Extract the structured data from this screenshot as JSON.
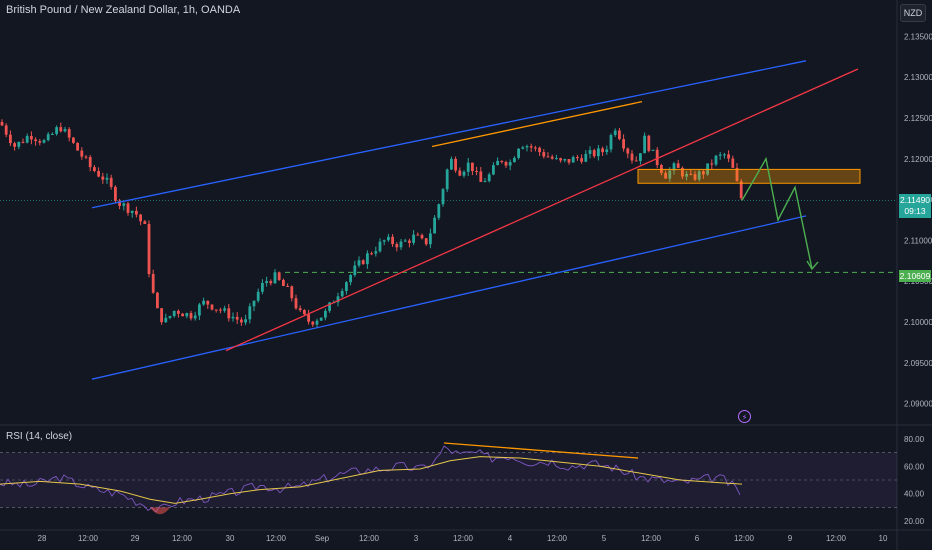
{
  "header": {
    "title": "British Pound / New Zealand Dollar, 1h, OANDA",
    "currency": "NZD"
  },
  "rsi": {
    "title": "RSI (14, close)"
  },
  "badges": {
    "price": "2.11490",
    "countdown": "09:13",
    "level": "2.10609"
  },
  "colors": {
    "background": "#131722",
    "bull": "#26a69a",
    "bear": "#ef5350",
    "channel": "#2962ff",
    "trend": "#f23645",
    "divergence": "#ff9800",
    "projection": "#4caf50",
    "rsi_line": "#7e57c2",
    "rsi_ma": "#e6c84a"
  },
  "chart_data": [
    {
      "type": "candlestick",
      "title": "British Pound / New Zealand Dollar, 1h, OANDA",
      "x_ticks": [
        "28",
        "12:00",
        "29",
        "12:00",
        "30",
        "12:00",
        "Sep",
        "12:00",
        "3",
        "12:00",
        "4",
        "12:00",
        "5",
        "12:00",
        "6",
        "12:00",
        "9",
        "12:00",
        "10"
      ],
      "y_ticks": [
        "2.13500",
        "2.13000",
        "2.12500",
        "2.12000",
        "2.11500",
        "2.11000",
        "2.10500",
        "2.10000",
        "2.09500",
        "2.09000"
      ],
      "ylim": [
        2.088,
        2.137
      ],
      "current_price": 2.1149,
      "key_level": 2.10609,
      "path": [
        [
          0,
          2.1245
        ],
        [
          15,
          2.1215
        ],
        [
          30,
          2.123
        ],
        [
          45,
          2.122
        ],
        [
          60,
          2.124
        ],
        [
          75,
          2.1215
        ],
        [
          90,
          2.119
        ],
        [
          105,
          2.1175
        ],
        [
          120,
          2.1145
        ],
        [
          135,
          2.1135
        ],
        [
          145,
          2.1115
        ],
        [
          150,
          2.105
        ],
        [
          158,
          2.101
        ],
        [
          165,
          2.1
        ],
        [
          175,
          2.1015
        ],
        [
          190,
          2.1008
        ],
        [
          205,
          2.1025
        ],
        [
          220,
          2.1015
        ],
        [
          235,
          2.1005
        ],
        [
          245,
          2.0998
        ],
        [
          255,
          2.103
        ],
        [
          265,
          2.105
        ],
        [
          275,
          2.1055
        ],
        [
          290,
          2.1035
        ],
        [
          300,
          2.101
        ],
        [
          310,
          2.1
        ],
        [
          325,
          2.101
        ],
        [
          340,
          2.104
        ],
        [
          355,
          2.1065
        ],
        [
          370,
          2.1085
        ],
        [
          385,
          2.11
        ],
        [
          400,
          2.1095
        ],
        [
          415,
          2.1105
        ],
        [
          425,
          2.1095
        ],
        [
          432,
          2.1115
        ],
        [
          440,
          2.115
        ],
        [
          450,
          2.12
        ],
        [
          460,
          2.1185
        ],
        [
          470,
          2.1195
        ],
        [
          480,
          2.117
        ],
        [
          490,
          2.118
        ],
        [
          500,
          2.12
        ],
        [
          510,
          2.1195
        ],
        [
          520,
          2.122
        ],
        [
          530,
          2.1215
        ],
        [
          545,
          2.1205
        ],
        [
          560,
          2.1195
        ],
        [
          575,
          2.12
        ],
        [
          590,
          2.1205
        ],
        [
          605,
          2.121
        ],
        [
          615,
          2.124
        ],
        [
          625,
          2.1215
        ],
        [
          635,
          2.1195
        ],
        [
          645,
          2.1225
        ],
        [
          655,
          2.12
        ],
        [
          665,
          2.118
        ],
        [
          675,
          2.119
        ],
        [
          690,
          2.1175
        ],
        [
          705,
          2.1185
        ],
        [
          715,
          2.12
        ],
        [
          725,
          2.1205
        ],
        [
          732,
          2.119
        ],
        [
          738,
          2.1165
        ],
        [
          742,
          2.1149
        ]
      ]
    },
    {
      "type": "line",
      "title": "RSI (14, close)",
      "y_ticks": [
        "80.00",
        "60.00",
        "40.00",
        "20.00"
      ],
      "ylim": [
        15,
        85
      ],
      "bands": [
        30,
        50,
        70
      ],
      "rsi": [
        [
          0,
          48
        ],
        [
          30,
          46
        ],
        [
          60,
          52
        ],
        [
          90,
          44
        ],
        [
          120,
          40
        ],
        [
          145,
          32
        ],
        [
          160,
          28
        ],
        [
          175,
          34
        ],
        [
          195,
          36
        ],
        [
          215,
          38
        ],
        [
          240,
          42
        ],
        [
          260,
          46
        ],
        [
          280,
          44
        ],
        [
          300,
          45
        ],
        [
          320,
          50
        ],
        [
          340,
          54
        ],
        [
          360,
          57
        ],
        [
          380,
          58
        ],
        [
          400,
          60
        ],
        [
          420,
          58
        ],
        [
          435,
          64
        ],
        [
          445,
          74
        ],
        [
          460,
          68
        ],
        [
          475,
          70
        ],
        [
          490,
          66
        ],
        [
          510,
          68
        ],
        [
          530,
          63
        ],
        [
          550,
          64
        ],
        [
          570,
          60
        ],
        [
          590,
          62
        ],
        [
          610,
          60
        ],
        [
          625,
          56
        ],
        [
          640,
          52
        ],
        [
          660,
          50
        ],
        [
          680,
          48
        ],
        [
          700,
          50
        ],
        [
          715,
          52
        ],
        [
          725,
          50
        ],
        [
          735,
          44
        ],
        [
          742,
          40
        ]
      ],
      "rsi_ma": [
        [
          0,
          47
        ],
        [
          40,
          49
        ],
        [
          80,
          47
        ],
        [
          120,
          42
        ],
        [
          150,
          36
        ],
        [
          175,
          33
        ],
        [
          200,
          36
        ],
        [
          230,
          40
        ],
        [
          260,
          43
        ],
        [
          300,
          45
        ],
        [
          340,
          51
        ],
        [
          380,
          57
        ],
        [
          420,
          58
        ],
        [
          450,
          64
        ],
        [
          480,
          67
        ],
        [
          520,
          66
        ],
        [
          560,
          63
        ],
        [
          600,
          60
        ],
        [
          640,
          55
        ],
        [
          680,
          50
        ],
        [
          720,
          48
        ],
        [
          742,
          47
        ]
      ]
    }
  ]
}
